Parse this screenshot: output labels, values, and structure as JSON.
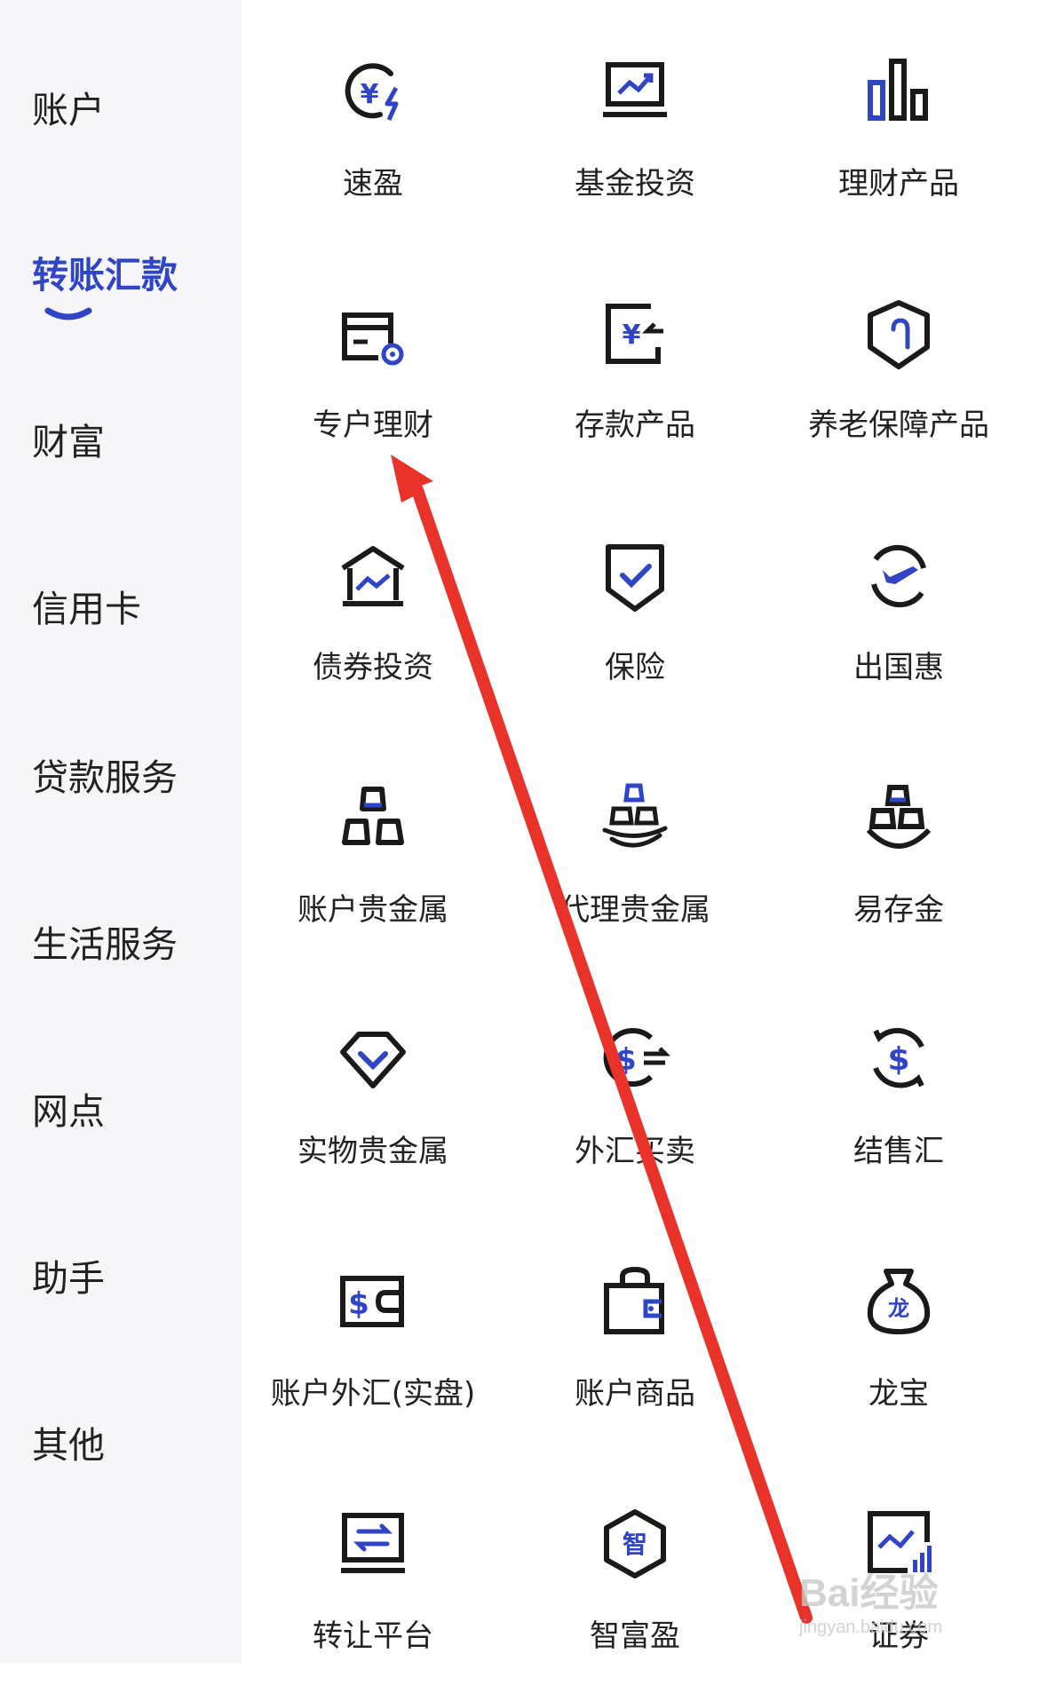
{
  "sidebar": {
    "items": [
      {
        "label": "账户"
      },
      {
        "label": "转账汇款"
      },
      {
        "label": "财富"
      },
      {
        "label": "信用卡"
      },
      {
        "label": "贷款服务"
      },
      {
        "label": "生活服务"
      },
      {
        "label": "网点"
      },
      {
        "label": "助手"
      },
      {
        "label": "其他"
      }
    ],
    "active_label": "转账汇款"
  },
  "grid": {
    "tiles": [
      {
        "label": "速盈",
        "icon": "yuan-lightning-icon"
      },
      {
        "label": "基金投资",
        "icon": "fund-chart-icon"
      },
      {
        "label": "理财产品",
        "icon": "bar-chart-icon"
      },
      {
        "label": "专户理财",
        "icon": "card-settings-icon"
      },
      {
        "label": "存款产品",
        "icon": "yuan-deposit-icon"
      },
      {
        "label": "养老保障产品",
        "icon": "shield-cane-icon"
      },
      {
        "label": "债券投资",
        "icon": "bank-building-icon"
      },
      {
        "label": "保险",
        "icon": "shield-check-icon"
      },
      {
        "label": "出国惠",
        "icon": "airplane-globe-icon"
      },
      {
        "label": "账户贵金属",
        "icon": "gold-bars-icon"
      },
      {
        "label": "代理贵金属",
        "icon": "gold-hand-icon"
      },
      {
        "label": "易存金",
        "icon": "gold-bowl-icon"
      },
      {
        "label": "实物贵金属",
        "icon": "diamond-icon"
      },
      {
        "label": "外汇买卖",
        "icon": "dollar-exchange-icon"
      },
      {
        "label": "结售汇",
        "icon": "dollar-cycle-icon"
      },
      {
        "label": "账户外汇(实盘)",
        "icon": "dollar-wallet-icon"
      },
      {
        "label": "账户商品",
        "icon": "shopping-bag-icon"
      },
      {
        "label": "龙宝",
        "icon": "money-bag-icon"
      },
      {
        "label": "转让平台",
        "icon": "transfer-monitor-icon"
      },
      {
        "label": "智富盈",
        "icon": "hexagon-zhi-icon"
      },
      {
        "label": "证券",
        "icon": "stock-chart-icon"
      }
    ]
  },
  "icon_text": {
    "yuan": "¥",
    "dollar": "$",
    "long": "龙",
    "zhi": "智"
  },
  "watermark": {
    "main": "Bai经验",
    "sub": "jingyan.baidu.com"
  },
  "colors": {
    "accent": "#2f45c6",
    "icon_dark": "#1a1a1a",
    "annotation_arrow": "#e8322a",
    "sidebar_bg": "#f6f6f8"
  }
}
